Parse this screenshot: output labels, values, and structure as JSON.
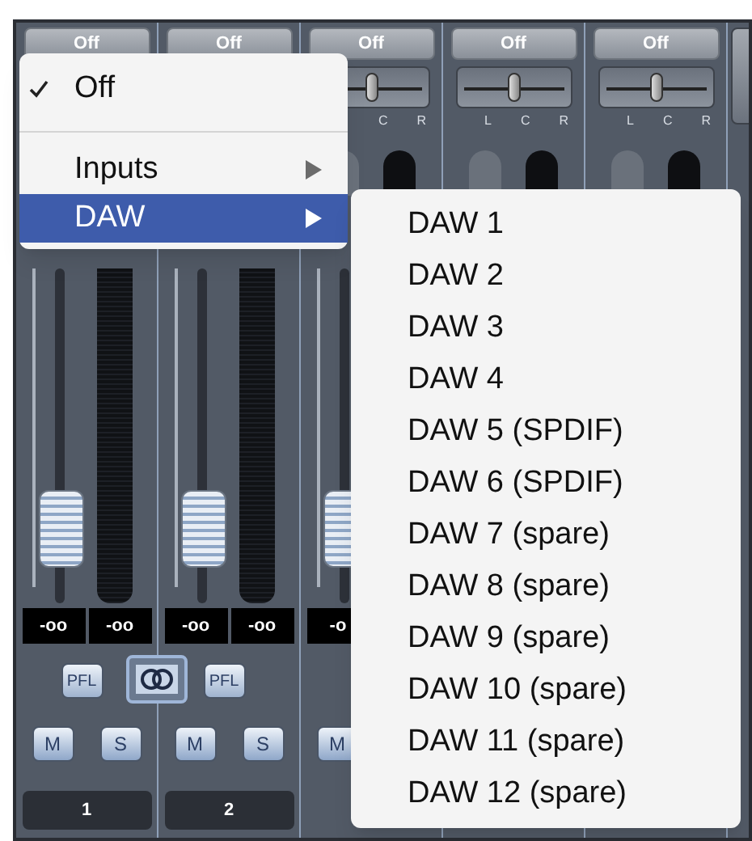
{
  "channels": [
    {
      "input": "Off",
      "fader": {
        "level": 0.15
      },
      "readouts": [
        "-oo",
        "-oo"
      ],
      "pfl": "PFL",
      "link": {
        "on": true
      },
      "mute": "M",
      "solo": "S",
      "number": "1"
    },
    {
      "input": "Off",
      "fader": {
        "level": 0.15
      },
      "readouts": [
        "-oo",
        "-oo"
      ],
      "pfl": "PFL",
      "mute": "M",
      "solo": "S",
      "number": "2"
    },
    {
      "input": "Off",
      "pan": {
        "level": 0.5
      },
      "pan_labels": [
        "C",
        "R"
      ],
      "fader": {
        "level": 0.15
      },
      "readouts": [
        "-o"
      ],
      "mute": "M"
    },
    {
      "input": "Off",
      "pan": {
        "level": 0.5
      },
      "pan_labels": [
        "L",
        "C",
        "R"
      ]
    },
    {
      "input": "Off",
      "pan": {
        "level": 0.5
      },
      "pan_labels": [
        "L",
        "C",
        "R"
      ]
    },
    {
      "kind": "cut_off"
    }
  ],
  "input_menu": {
    "items": [
      {
        "label": "Off",
        "checked": true,
        "selected": false,
        "submenu": false
      },
      {
        "label": "Inputs",
        "checked": false,
        "selected": false,
        "submenu": true
      },
      {
        "label": "DAW",
        "checked": false,
        "selected": true,
        "submenu": true
      }
    ]
  },
  "daw_submenu": {
    "items": [
      "DAW 1",
      "DAW 2",
      "DAW 3",
      "DAW 4",
      "DAW 5 (SPDIF)",
      "DAW 6 (SPDIF)",
      "DAW 7 (spare)",
      "DAW 8 (spare)",
      "DAW 9 (spare)",
      "DAW 10 (spare)",
      "DAW 11 (spare)",
      "DAW 12 (spare)"
    ]
  }
}
